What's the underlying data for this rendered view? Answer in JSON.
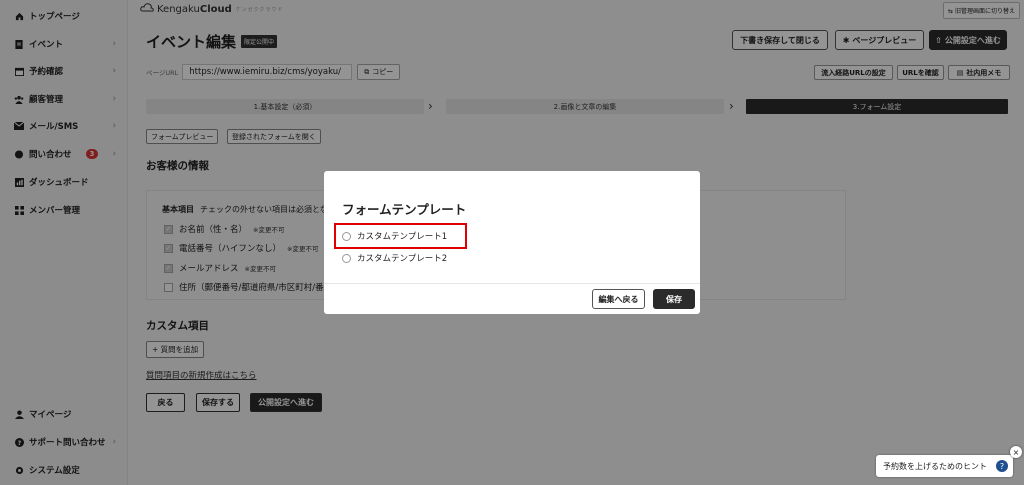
{
  "sidebar": {
    "items": [
      {
        "label": "トップページ",
        "icon": "home-icon",
        "chev": ""
      },
      {
        "label": "イベント",
        "icon": "document-icon",
        "chev": "›"
      },
      {
        "label": "予約確認",
        "icon": "calendar-icon",
        "chev": "›"
      },
      {
        "label": "顧客管理",
        "icon": "users-icon",
        "chev": "›"
      },
      {
        "label": "メール/SMS",
        "icon": "mail-icon",
        "chev": "›"
      },
      {
        "label": "問い合わせ",
        "icon": "chat-icon",
        "chev": "›",
        "badge": "3"
      },
      {
        "label": "ダッシュボード",
        "icon": "chart-icon",
        "chev": ""
      },
      {
        "label": "メンバー管理",
        "icon": "grid-icon",
        "chev": ""
      }
    ],
    "bottom": [
      {
        "label": "マイページ",
        "icon": "person-icon",
        "chev": ""
      },
      {
        "label": "サポート問い合わせ",
        "icon": "help-icon",
        "chev": "›"
      },
      {
        "label": "システム設定",
        "icon": "gear-icon",
        "chev": ""
      }
    ]
  },
  "brand": {
    "name_a": "Kengaku",
    "name_b": "Cloud",
    "sub": "ケンガククラウド"
  },
  "header": {
    "switch_label": "旧管理画面に切り替え",
    "title": "イベント編集",
    "status_pill": "限定公開中",
    "save_close": "下書き保存して閉じる",
    "preview": "ページプレビュー",
    "publish": "公開設定へ進む"
  },
  "url_row": {
    "label": "ページURL",
    "value": "https://www.iemiru.biz/cms/yoyaku/",
    "copy": "コピー",
    "inflow": "流入経路URLの設定",
    "check": "URLを確認",
    "memo": "社内用メモ"
  },
  "steps": [
    "1.基本設定（必須）",
    "2.画像と文章の編集",
    "3.フォーム設定"
  ],
  "form_buttons": {
    "preview": "フォームプレビュー",
    "open_registered": "登録されたフォームを開く"
  },
  "customer": {
    "title": "お客様の情報",
    "basic_label": "基本項目",
    "basic_hint": "チェックの外せない項目は必須とな",
    "fields": [
      {
        "label": "お名前（性・名）",
        "note": "※変更不可",
        "checked": true
      },
      {
        "label": "電話番号（ハイフンなし）",
        "note": "※変更不可",
        "checked": true
      },
      {
        "label": "メールアドレス",
        "note": "※変更不可",
        "checked": true
      },
      {
        "label": "住所（郵便番号/都道府県/市区町村/番",
        "note": "",
        "checked": false
      }
    ]
  },
  "custom": {
    "title": "カスタム項目",
    "add": "+ 質問を追加",
    "link": "質問項目の新規作成はこちら"
  },
  "bottom_buttons": {
    "back": "戻る",
    "save": "保存する",
    "publish": "公開設定へ進む"
  },
  "modal": {
    "title": "フォームテンプレート",
    "options": [
      "カスタムテンプレート1",
      "カスタムテンプレート2"
    ],
    "back": "編集へ戻る",
    "save": "保存"
  },
  "hint": {
    "label": "予約数を上げるためのヒント",
    "q": "?",
    "close": "×"
  },
  "colors": {
    "accent": "#2b2b2b",
    "highlight": "#e00000",
    "badge": "#d33333",
    "help": "#1e4f8f"
  }
}
